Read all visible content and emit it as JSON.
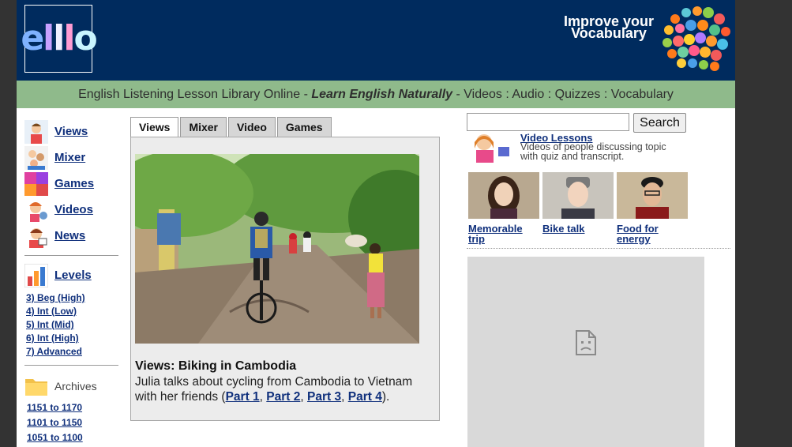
{
  "header": {
    "logo_text": "ello",
    "promo_line1": "Improve your",
    "promo_line2": "Vocabulary"
  },
  "subnav": {
    "part1": "English Listening Lesson Library Online - ",
    "tagline": "Learn English Naturally",
    "part2": " - Videos : Audio : Quizzes : Vocabulary"
  },
  "sidebar": {
    "items": [
      {
        "label": "Views",
        "icon": "views-icon"
      },
      {
        "label": "Mixer",
        "icon": "mixer-icon"
      },
      {
        "label": "Games",
        "icon": "games-icon"
      },
      {
        "label": "Videos",
        "icon": "videos-icon"
      },
      {
        "label": "News",
        "icon": "news-icon"
      }
    ],
    "levels_label": "Levels",
    "levels": [
      "3) Beg (High)",
      "4) Int (Low)",
      "5) Int (Mid)",
      "6) Int (High)",
      "7) Advanced"
    ],
    "archives_label": "Archives",
    "archives": [
      "1151 to 1170",
      "1101 to 1150",
      "1051 to 1100"
    ]
  },
  "tabs": [
    "Views",
    "Mixer",
    "Video",
    "Games"
  ],
  "feature": {
    "title": "Views: Biking in Cambodia",
    "text": "Julia talks about cycling from Cambodia to Vietnam with her friends (",
    "parts": [
      "Part 1",
      "Part 2",
      "Part 3",
      "Part 4"
    ],
    "text_end": ")."
  },
  "search": {
    "button": "Search",
    "value": ""
  },
  "video_lessons": {
    "title": "Video Lessons",
    "desc": "Videos of people discussing topic with quiz and transcript."
  },
  "thumbs": [
    {
      "label_line1": "Memorable",
      "label_line2": "trip"
    },
    {
      "label_line1": "Bike talk",
      "label_line2": ""
    },
    {
      "label_line1": "Food for",
      "label_line2": "energy"
    }
  ],
  "colors": {
    "header_bg": "#002b5e",
    "subnav_bg": "#8fba8b",
    "link": "#10307c",
    "backdrop": "#333333"
  }
}
